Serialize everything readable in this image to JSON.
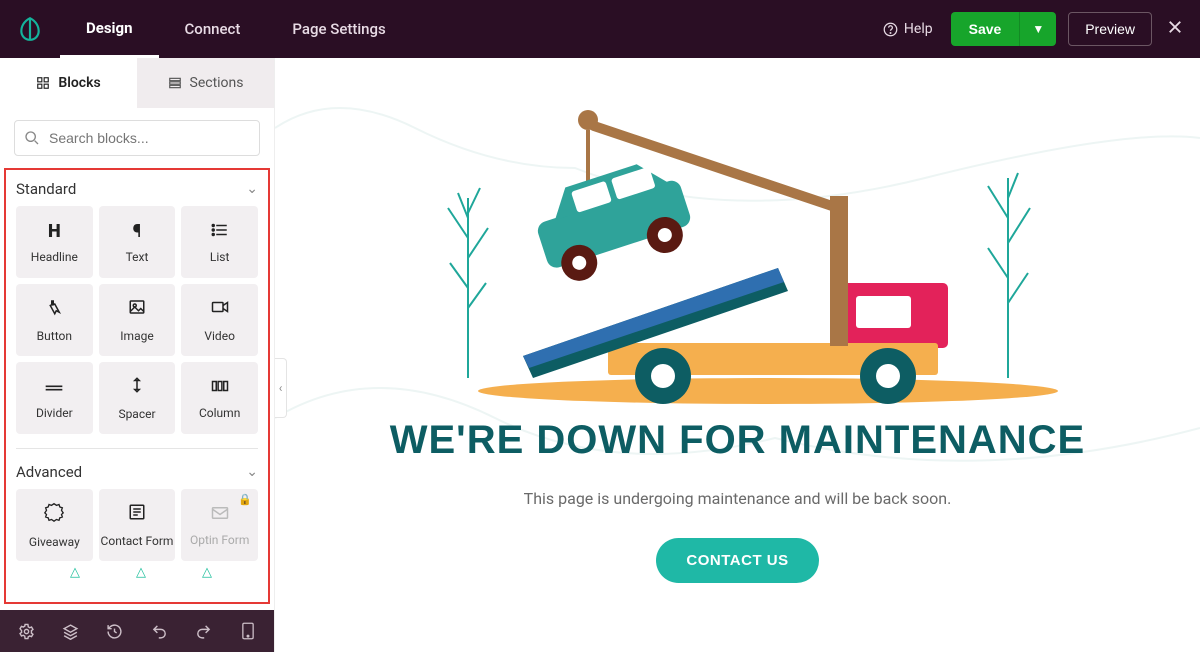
{
  "topbar": {
    "tabs": {
      "design": "Design",
      "connect": "Connect",
      "page_settings": "Page Settings"
    },
    "help": "Help",
    "save": "Save",
    "preview": "Preview"
  },
  "sidebar": {
    "tabs": {
      "blocks": "Blocks",
      "sections": "Sections"
    },
    "search_placeholder": "Search blocks...",
    "groups": {
      "standard": {
        "title": "Standard",
        "items": [
          {
            "label": "Headline"
          },
          {
            "label": "Text"
          },
          {
            "label": "List"
          },
          {
            "label": "Button"
          },
          {
            "label": "Image"
          },
          {
            "label": "Video"
          },
          {
            "label": "Divider"
          },
          {
            "label": "Spacer"
          },
          {
            "label": "Column"
          }
        ]
      },
      "advanced": {
        "title": "Advanced",
        "items": [
          {
            "label": "Giveaway"
          },
          {
            "label": "Contact Form"
          },
          {
            "label": "Optin Form",
            "locked": true
          }
        ]
      }
    }
  },
  "preview": {
    "headline": "WE'RE DOWN FOR MAINTENANCE",
    "subtext": "This page is undergoing maintenance and will be back soon.",
    "cta": "CONTACT US"
  }
}
